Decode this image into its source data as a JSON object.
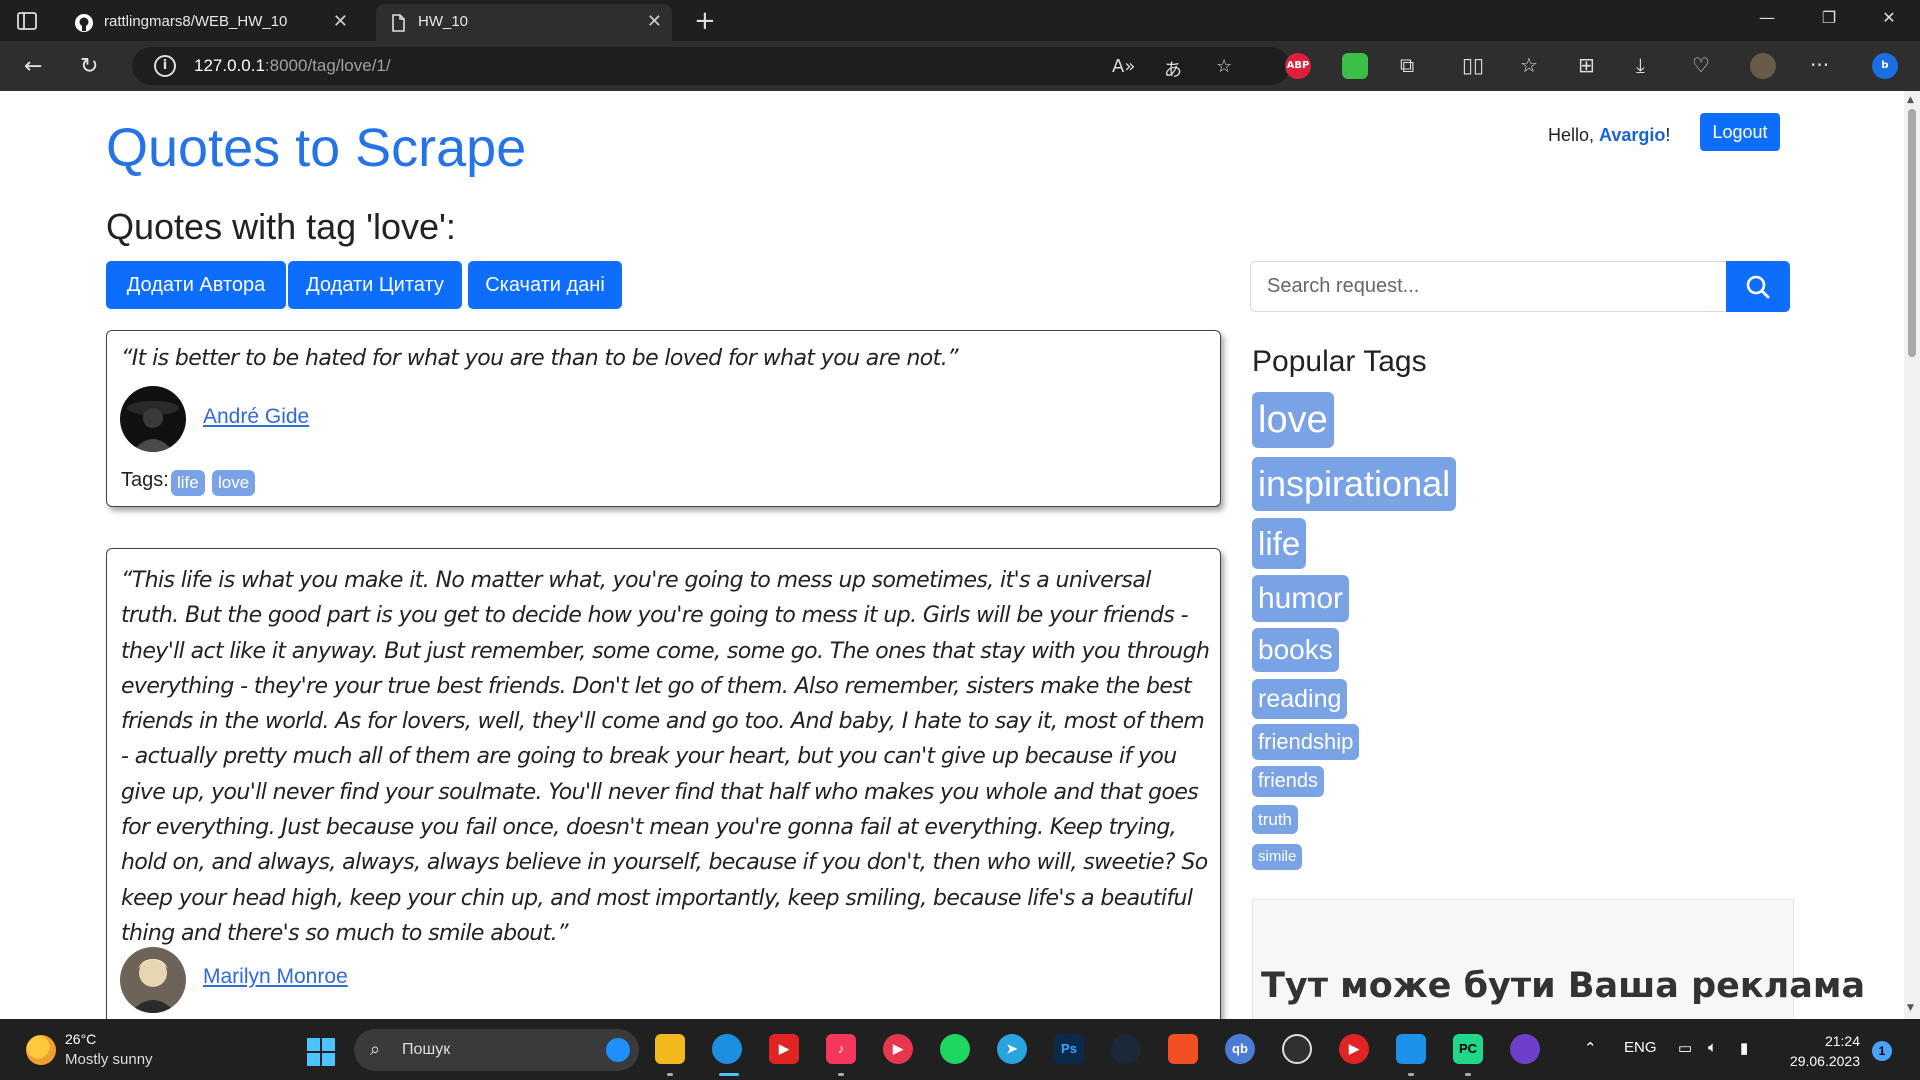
{
  "browser": {
    "tabs": [
      {
        "title": "rattlingmars8/WEB_HW_10",
        "icon": "github-icon",
        "active": false
      },
      {
        "title": "HW_10",
        "icon": "document-icon",
        "active": true
      }
    ],
    "address": {
      "host": "127.0.0.1",
      "rest": ":8000/tag/love/1/"
    },
    "extensions": [
      {
        "name": "adblock-plus-icon",
        "label": "ABP",
        "color": "#e0203a"
      },
      {
        "name": "extension-green-icon",
        "label": "",
        "color": "#3bbf4a"
      }
    ]
  },
  "page": {
    "brand": "Quotes to Scrape",
    "greeting": {
      "prefix": "Hello, ",
      "user": "Avargio",
      "suffix": "!"
    },
    "logout_label": "Logout",
    "heading": "Quotes with tag 'love':",
    "actions": {
      "add_author": "Додати Автора",
      "add_quote": "Додати Цитату",
      "download": "Скачати дані"
    },
    "search": {
      "placeholder": "Search request..."
    },
    "quotes": [
      {
        "text": "“It is better to be hated for what you are than to be loved for what you are not.”",
        "author": " André Gide",
        "tags_label": "Tags:",
        "tags": [
          "life",
          "love"
        ]
      },
      {
        "text": "“This life is what you make it. No matter what, you're going to mess up sometimes, it's a universal truth. But the good part is you get to decide how you're going to mess it up. Girls will be your friends - they'll act like it anyway. But just remember, some come, some go. The ones that stay with you through everything - they're your true best friends. Don't let go of them. Also remember, sisters make the best friends in the world. As for lovers, well, they'll come and go too. And baby, I hate to say it, most of them - actually pretty much all of them are going to break your heart, but you can't give up because if you give up, you'll never find your soulmate. You'll never find that half who makes you whole and that goes for everything. Just because you fail once, doesn't mean you're gonna fail at everything. Keep trying, hold on, and always, always, always believe in yourself, because if you don't, then who will, sweetie? So keep your head high, keep your chin up, and most importantly, keep smiling, because life's a beautiful thing and there's so much to smile about.”",
        "author": " Marilyn Monroe"
      }
    ],
    "popular_tags_title": "Popular Tags",
    "popular_tags": [
      "love",
      "inspirational",
      "life",
      "humor",
      "books",
      "reading",
      "friendship",
      "friends",
      "truth",
      "simile"
    ],
    "ad_text": "Тут може бути Ваша реклама"
  },
  "taskbar": {
    "weather": {
      "temp": "26°C",
      "desc": "Mostly sunny"
    },
    "search_label": "Пошук",
    "lang": "ENG",
    "time": "21:24",
    "date": "29.06.2023",
    "notifications": "1"
  }
}
